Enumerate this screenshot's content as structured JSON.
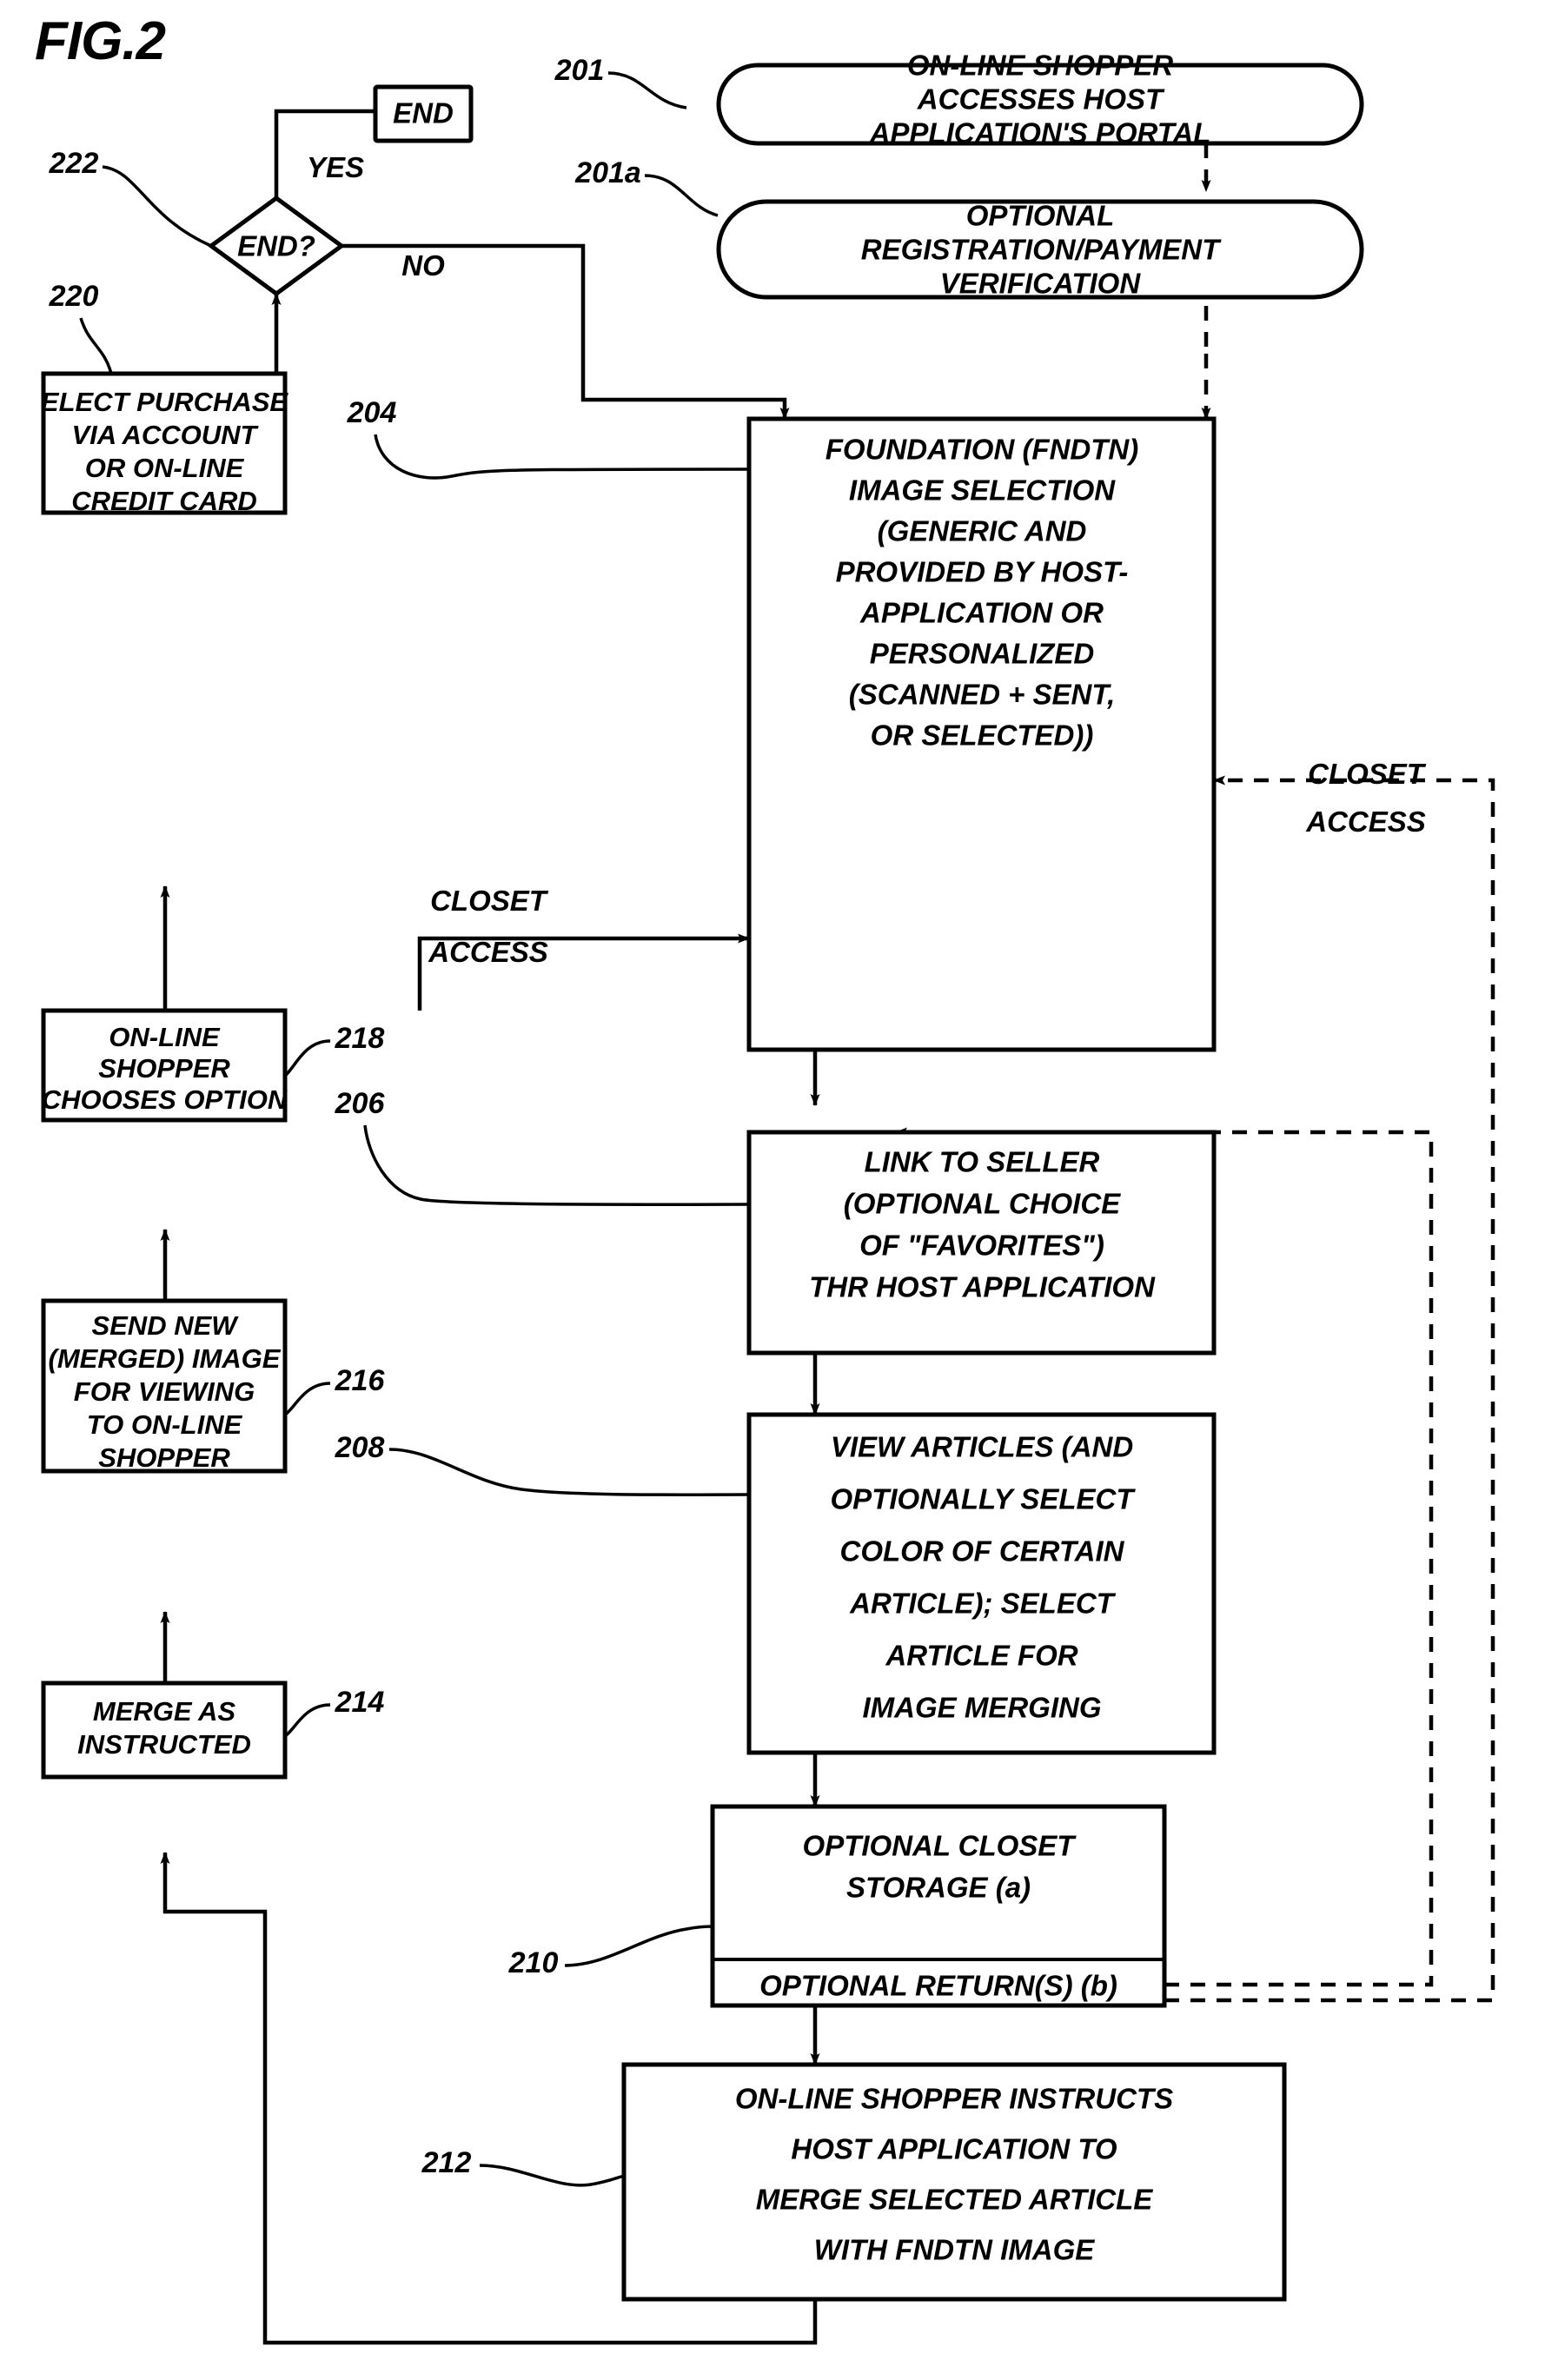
{
  "figure": {
    "title": "FIG.2",
    "type": "patent-flowchart"
  },
  "nodes": {
    "end_terminal": {
      "ref": "",
      "label": "END"
    },
    "n222": {
      "ref": "222",
      "label": "END?"
    },
    "n220": {
      "ref": "220",
      "lines": [
        "ELECT PURCHASE",
        "VIA ACCOUNT",
        "OR ON-LINE",
        "CREDIT CARD"
      ]
    },
    "n218": {
      "ref": "218",
      "lines": [
        "ON-LINE",
        "SHOPPER",
        "CHOOSES OPTION"
      ]
    },
    "n216": {
      "ref": "216",
      "lines": [
        "SEND NEW",
        "(MERGED) IMAGE",
        "FOR VIEWING",
        "TO ON-LINE",
        "SHOPPER"
      ]
    },
    "n214": {
      "ref": "214",
      "lines": [
        "MERGE AS",
        "INSTRUCTED"
      ]
    },
    "n201": {
      "ref": "201",
      "lines": [
        "ON-LINE SHOPPER",
        "ACCESSES HOST",
        "APPLICATION'S PORTAL"
      ]
    },
    "n201a": {
      "ref": "201a",
      "lines": [
        "OPTIONAL",
        "REGISTRATION/PAYMENT",
        "VERIFICATION"
      ]
    },
    "n204": {
      "ref": "204",
      "lines": [
        "FOUNDATION (FNDTN)",
        "IMAGE SELECTION",
        "(GENERIC AND",
        "PROVIDED BY HOST-",
        "APPLICATION OR",
        "PERSONALIZED",
        "(SCANNED + SENT,",
        "OR SELECTED))"
      ]
    },
    "n206": {
      "ref": "206",
      "lines": [
        "LINK TO SELLER",
        "(OPTIONAL CHOICE",
        "OF \"FAVORITES\")",
        "THR HOST APPLICATION"
      ]
    },
    "n208": {
      "ref": "208",
      "lines": [
        "VIEW ARTICLES (AND",
        "OPTIONALLY SELECT",
        "COLOR OF CERTAIN",
        "ARTICLE); SELECT",
        "ARTICLE FOR",
        "IMAGE MERGING"
      ]
    },
    "n210": {
      "ref": "210",
      "line_a": "OPTIONAL CLOSET",
      "line_a2": "STORAGE (a)",
      "line_b": "OPTIONAL RETURN(S) (b)"
    },
    "n212": {
      "ref": "212",
      "lines": [
        "ON-LINE SHOPPER INSTRUCTS",
        "HOST APPLICATION TO",
        "MERGE SELECTED ARTICLE",
        "WITH FNDTN IMAGE"
      ]
    }
  },
  "edge_labels": {
    "yes": "YES",
    "no": "NO",
    "closet_access_left_1": "CLOSET",
    "closet_access_left_2": "ACCESS",
    "closet_access_right_1": "CLOSET",
    "closet_access_right_2": "ACCESS"
  },
  "colors": {
    "ink": "#000000",
    "paper": "#ffffff"
  }
}
